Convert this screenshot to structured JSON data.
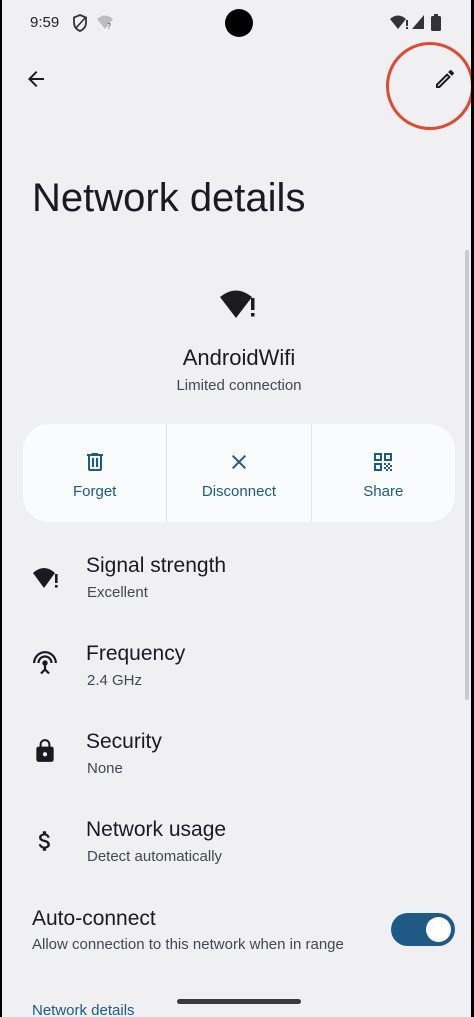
{
  "status_bar": {
    "time": "9:59"
  },
  "page": {
    "title": "Network details"
  },
  "network": {
    "name": "AndroidWifi",
    "status": "Limited connection"
  },
  "actions": [
    {
      "label": "Forget",
      "icon": "trash-icon"
    },
    {
      "label": "Disconnect",
      "icon": "close-icon"
    },
    {
      "label": "Share",
      "icon": "qr-code-icon"
    }
  ],
  "details": [
    {
      "title": "Signal strength",
      "value": "Excellent",
      "icon": "wifi-alert-icon"
    },
    {
      "title": "Frequency",
      "value": "2.4 GHz",
      "icon": "antenna-icon"
    },
    {
      "title": "Security",
      "value": "None",
      "icon": "lock-icon"
    },
    {
      "title": "Network usage",
      "value": "Detect automatically",
      "icon": "dollar-icon"
    }
  ],
  "auto_connect": {
    "title": "Auto-connect",
    "subtitle": "Allow connection to this network when in range",
    "enabled": true
  },
  "next_section": "Network details",
  "colors": {
    "accent": "#1d5a84",
    "toggle": "#1f5a87",
    "highlight_ring": "#e2472f",
    "background": "#f0f0f3"
  }
}
